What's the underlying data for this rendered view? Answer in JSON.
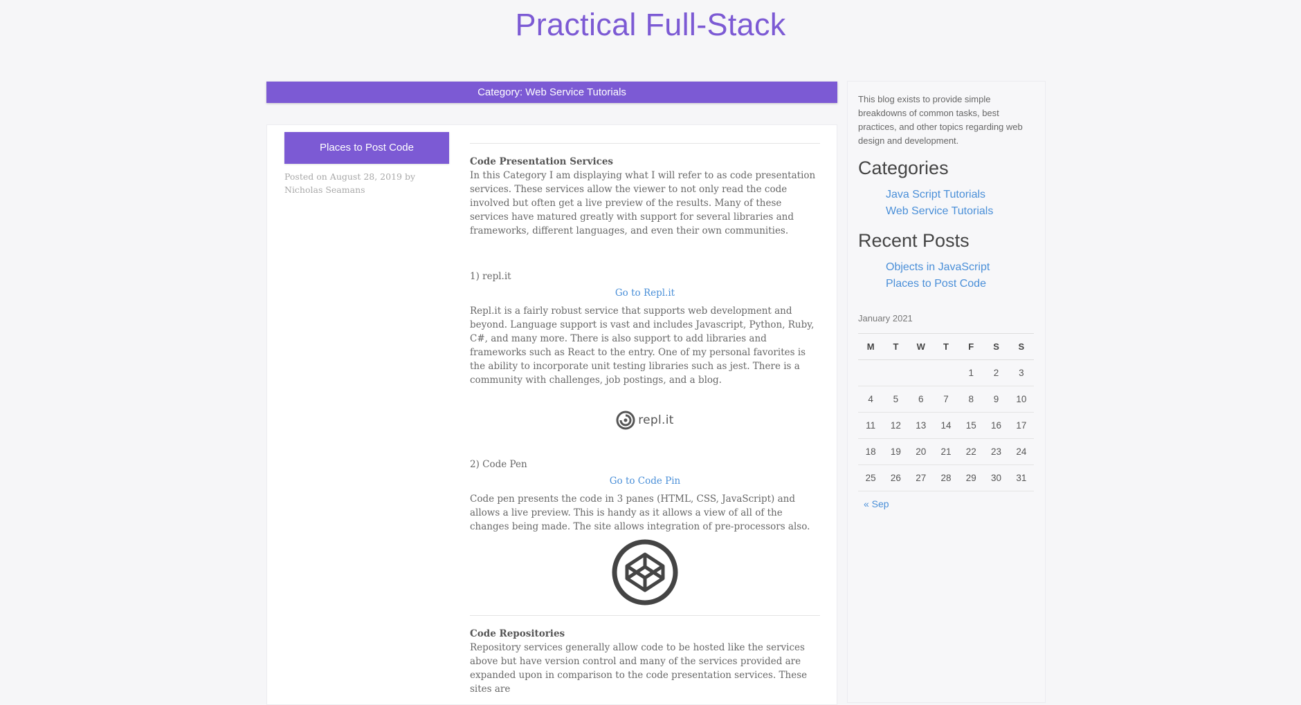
{
  "site": {
    "title": "Practical Full-Stack"
  },
  "category_bar": {
    "label": "Category: Web Service Tutorials"
  },
  "post": {
    "title_button": "Places to Post Code",
    "meta": "Posted on August 28, 2019 by Nicholas Seamans",
    "sections": {
      "presentation": {
        "heading": "Code Presentation Services",
        "intro": "In this Category I am displaying what I will refer to as code presentation services. These services allow the viewer to not only read the code involved but often get a live preview of the results. Many of these services have matured greatly with support for several libraries and frameworks, different languages, and even their own communities."
      },
      "replit": {
        "number": "1) repl.it",
        "link": "Go to Repl.it",
        "body": "Repl.it is a fairly robust service that supports web development and beyond. Language support is vast and includes Javascript, Python, Ruby, C#, and many more. There is also support to add libraries and frameworks such as React to the entry. One of my personal favorites is the ability to incorporate unit testing libraries such as jest. There is a community with challenges, job postings, and a blog.",
        "logo_text": "repl.it"
      },
      "codepen": {
        "number": "2) Code Pen",
        "link": "Go to Code Pin",
        "body": "Code pen presents the code in 3 panes (HTML, CSS, JavaScript) and allows a live preview. This is handy as it allows a view of all of the changes being made. The site allows integration of pre-processors also."
      },
      "repos": {
        "heading": "Code Repositories",
        "body": "Repository services generally allow code to be hosted like the services above but have version control and many of the services provided are expanded upon in comparison to the code presentation services. These sites are"
      }
    }
  },
  "sidebar": {
    "about": "This blog exists to provide simple breakdowns of common tasks, best practices, and other topics regarding web design and development.",
    "categories_heading": "Categories",
    "categories": [
      "Java Script Tutorials",
      "Web Service Tutorials"
    ],
    "recent_heading": "Recent Posts",
    "recent": [
      "Objects in JavaScript",
      "Places to Post Code"
    ],
    "calendar": {
      "caption": "January 2021",
      "days": [
        "M",
        "T",
        "W",
        "T",
        "F",
        "S",
        "S"
      ],
      "weeks": [
        [
          "",
          "",
          "",
          "",
          "1",
          "2",
          "3"
        ],
        [
          "4",
          "5",
          "6",
          "7",
          "8",
          "9",
          "10"
        ],
        [
          "11",
          "12",
          "13",
          "14",
          "15",
          "16",
          "17"
        ],
        [
          "18",
          "19",
          "20",
          "21",
          "22",
          "23",
          "24"
        ],
        [
          "25",
          "26",
          "27",
          "28",
          "29",
          "30",
          "31"
        ]
      ],
      "prev": "« Sep"
    }
  },
  "colors": {
    "accent": "#7c5ad4",
    "link": "#4a8fd8"
  }
}
